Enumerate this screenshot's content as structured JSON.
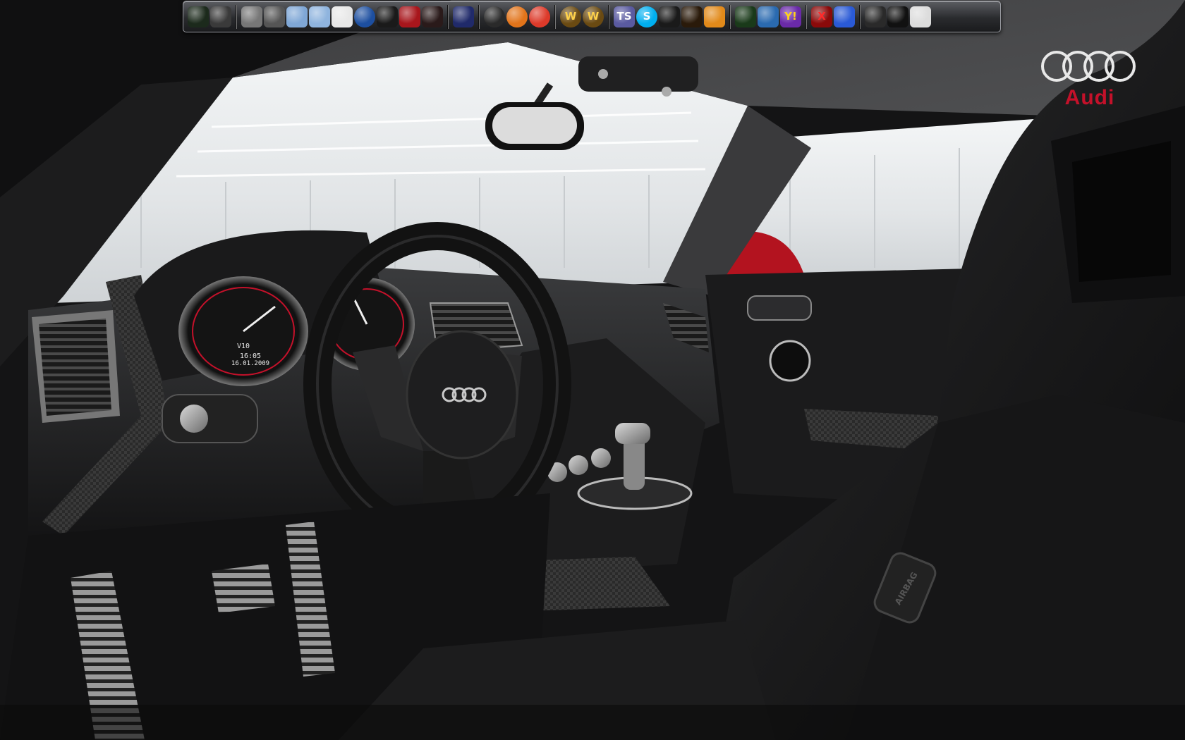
{
  "desktop": {
    "brand_text": "Audi",
    "cluster": {
      "model": "V10",
      "time": "16:05",
      "date": "16.01.2009"
    },
    "airbag_label": "AIRBAG"
  },
  "dock": {
    "groups": [
      [
        {
          "icon": "skull-crossbones-icon",
          "label": "",
          "bg": "#1c2a1c",
          "fg": "#3ee23e"
        },
        {
          "icon": "whiskey-bottle-icon",
          "label": "",
          "bg": "#3a3a3a",
          "fg": "#e0e0e0"
        }
      ],
      [
        {
          "icon": "trash-can-icon",
          "label": "",
          "bg": "#777",
          "fg": "#222"
        },
        {
          "icon": "tools-icon",
          "label": "",
          "bg": "#555",
          "fg": "#ddd"
        },
        {
          "icon": "hard-drive-icon",
          "label": "",
          "bg": "#7fa7d6",
          "fg": "#fff"
        },
        {
          "icon": "network-drive-icon",
          "label": "",
          "bg": "#8fb4de",
          "fg": "#fff"
        },
        {
          "icon": "mouse-icon",
          "label": "",
          "bg": "#e8e8e8",
          "fg": "#555"
        },
        {
          "icon": "globe-icon",
          "label": "",
          "bg": "#1d4fa0",
          "fg": "#fff"
        },
        {
          "icon": "pirate-icon",
          "label": "",
          "bg": "#1a1a1a",
          "fg": "#ddd"
        },
        {
          "icon": "devil-icon",
          "label": "",
          "bg": "#a8161c",
          "fg": "#ffce3a"
        },
        {
          "icon": "pinup-girl-icon",
          "label": "",
          "bg": "#2a1a1a",
          "fg": "#e24a4a"
        }
      ],
      [
        {
          "icon": "media-player-icon",
          "label": "",
          "bg": "#202a6a",
          "fg": "#ff3b3b"
        }
      ],
      [
        {
          "icon": "winamp-icon",
          "label": "",
          "bg": "#2a2a2a",
          "fg": "#f2b21a"
        },
        {
          "icon": "firefox-icon",
          "label": "",
          "bg": "#e2741a",
          "fg": "#2a4fa8"
        },
        {
          "icon": "chrome-icon",
          "label": "",
          "bg": "#dd3a2a",
          "fg": "#3aa84a"
        }
      ],
      [
        {
          "icon": "world-of-warcraft-icon",
          "label": "W",
          "bg": "#6a4a12",
          "fg": "#ffd24a"
        },
        {
          "icon": "world-of-warcraft-icon",
          "label": "W",
          "bg": "#6a4a12",
          "fg": "#ffd24a"
        }
      ],
      [
        {
          "icon": "teamspeak-icon",
          "label": "TS",
          "bg": "#5a5aa0",
          "fg": "#fff"
        },
        {
          "icon": "skype-icon",
          "label": "S",
          "bg": "#00aff0",
          "fg": "#fff"
        },
        {
          "icon": "steam-icon",
          "label": "",
          "bg": "#1a1a1a",
          "fg": "#eee"
        },
        {
          "icon": "flame-icon",
          "label": "",
          "bg": "#2a1a0a",
          "fg": "#ff7a1a"
        },
        {
          "icon": "spiral-icon",
          "label": "",
          "bg": "#e28a1a",
          "fg": "#6a2aa8"
        }
      ],
      [
        {
          "icon": "icq-flower-icon",
          "label": "",
          "bg": "#1a3a1a",
          "fg": "#5ad63a"
        },
        {
          "icon": "msn-messenger-icon",
          "label": "",
          "bg": "#2a6ab0",
          "fg": "#5ad63a"
        },
        {
          "icon": "yahoo-messenger-icon",
          "label": "Y!",
          "bg": "#6a2aa8",
          "fg": "#ffd21a"
        }
      ],
      [
        {
          "icon": "x-app-icon",
          "label": "X",
          "bg": "#8a0a0a",
          "fg": "#ff2a2a"
        },
        {
          "icon": "colorful-app-icon",
          "label": "",
          "bg": "#2a5ad6",
          "fg": "#ffb21a"
        }
      ],
      [
        {
          "icon": "display-settings-icon",
          "label": "",
          "bg": "#2a2a2a",
          "fg": "#ddd"
        },
        {
          "icon": "monitor-icon",
          "label": "",
          "bg": "#111",
          "fg": "#fff"
        },
        {
          "icon": "desktop-icon",
          "label": "",
          "bg": "#dcdcdc",
          "fg": "#444"
        }
      ]
    ]
  },
  "colors": {
    "brand_red": "#c4112a",
    "car_red": "#b3131f"
  }
}
